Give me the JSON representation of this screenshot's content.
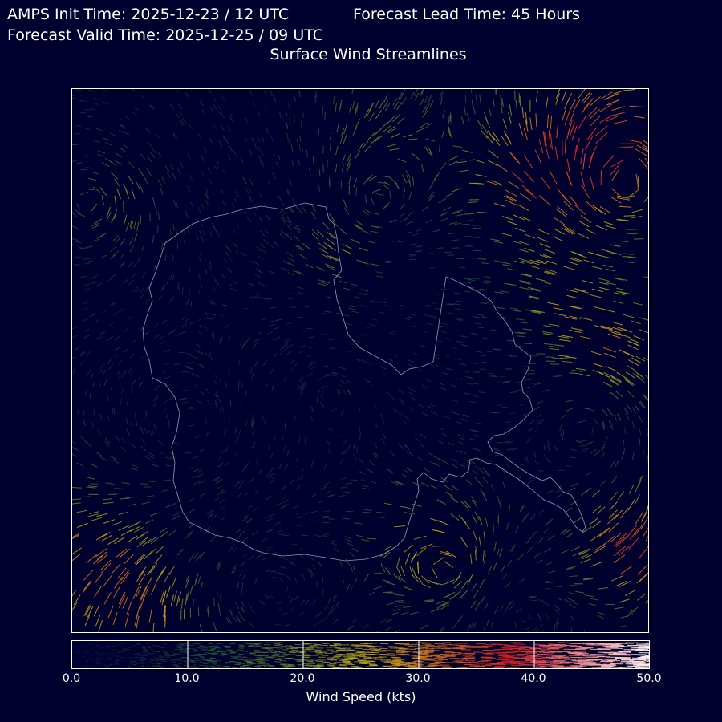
{
  "header": {
    "init_time": "AMPS Init Time: 2025-12-23 / 12 UTC",
    "lead_time": "Forecast Lead Time: 45 Hours",
    "valid_time": "Forecast Valid Time: 2025-12-25 / 09 UTC",
    "map_title": "Surface Wind Streamlines"
  },
  "colorbar": {
    "label": "Wind Speed (kts)",
    "ticks": [
      "0.0",
      "10.0",
      "20.0",
      "30.0",
      "40.0",
      "50.0"
    ],
    "range": [
      0,
      50
    ],
    "colors": [
      "#0a0a50",
      "#2e6e3a",
      "#c8b414",
      "#e02020",
      "#ffffff"
    ]
  },
  "map": {
    "region": "Antarctica",
    "layers": [
      "wind-streamlines",
      "coastline-outline"
    ],
    "coastline_color": "#c8c8d8"
  }
}
